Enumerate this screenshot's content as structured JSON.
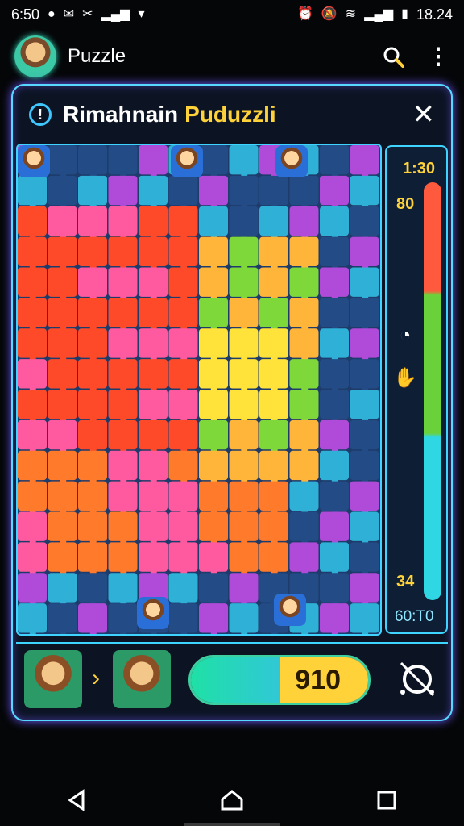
{
  "status_bar": {
    "time_left": "6:50",
    "time_right": "18.24",
    "left_icons": [
      "notification-icon",
      "mail-icon",
      "app-icon",
      "signal-icon",
      "wifi-icon"
    ],
    "right_icons": [
      "alarm-icon",
      "mute-icon",
      "wifi-icon",
      "signal-icon",
      "battery-icon"
    ]
  },
  "appbar": {
    "title": "Puzzle"
  },
  "game": {
    "title_part1": "Rimahnain",
    "title_part2": "Puduzzli"
  },
  "sidebar": {
    "timer": "1:30",
    "top_value": "80",
    "bottom_value": "34",
    "last_value": "60:T0"
  },
  "footer": {
    "score": "910",
    "progress": 0.5
  },
  "colors": {
    "accent": "#3fd4ff",
    "yellow": "#ffd23a",
    "green": "#6bd13a",
    "red": "#ff5a3d",
    "teal": "#2fd6e3"
  }
}
